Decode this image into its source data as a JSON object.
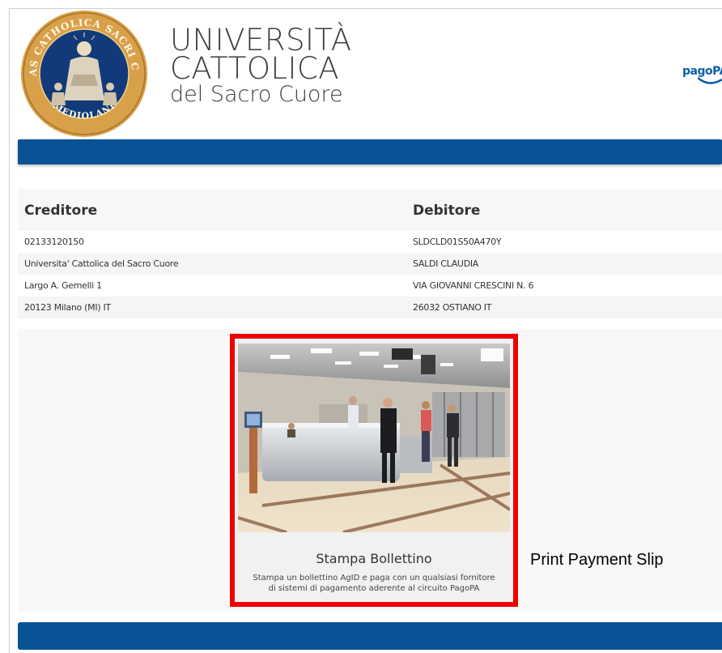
{
  "header": {
    "seal_text_top": "UNIVERSITAS CATHOLICA SACRI CORDIS IESU",
    "seal_text_bottom": "MEDIOLANI",
    "university_line1": "UNIVERSITÀ",
    "university_line2": "CATTOLICA",
    "university_line3": "del Sacro Cuore",
    "pagopa_logo": "pagoPA"
  },
  "info": {
    "creditor_heading": "Creditore",
    "debtor_heading": "Debitore",
    "rows": [
      {
        "creditor": "02133120150",
        "debtor": "SLDCLD01S50A470Y"
      },
      {
        "creditor": "Universita' Cattolica del Sacro Cuore",
        "debtor": "SALDI CLAUDIA"
      },
      {
        "creditor": "Largo A. Gemelli 1",
        "debtor": "VIA GIOVANNI CRESCINI N. 6"
      },
      {
        "creditor": "20123 Milano (MI) IT",
        "debtor": "26032 OSTIANO IT"
      }
    ]
  },
  "card": {
    "title": "Stampa Bollettino",
    "description_line1": "Stampa un bollettino AgID e paga con un qualsiasi fornitore",
    "description_line2": "di sistemi di pagamento aderente al circuito PagoPA",
    "highlight_color": "#ee0000"
  },
  "annotation": {
    "label": "Print Payment Slip"
  },
  "colors": {
    "brand_blue": "#0a5296",
    "seal_gold": "#d9a04a",
    "seal_blue": "#123a7a"
  }
}
